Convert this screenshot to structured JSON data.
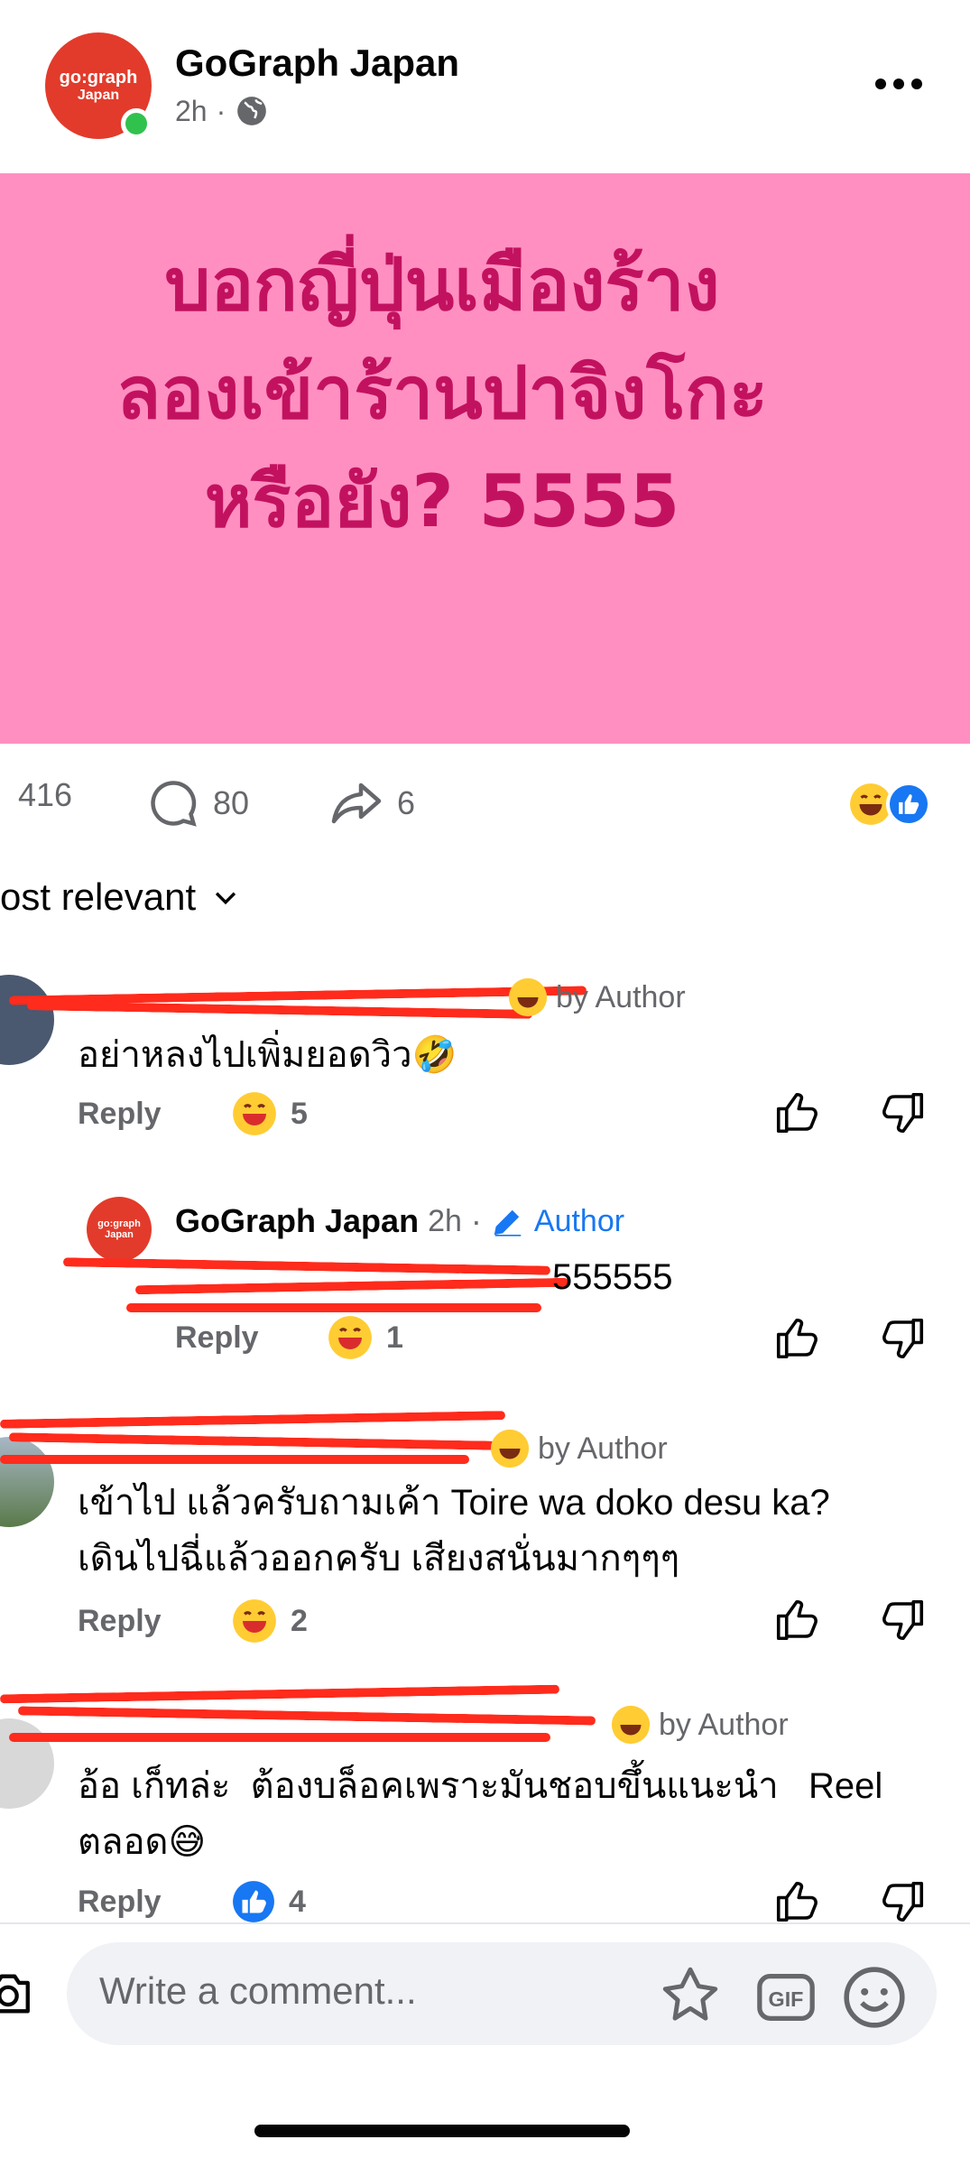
{
  "post": {
    "page_name": "GoGraph Japan",
    "avatar_text_line1": "go:graph",
    "avatar_text_line2": "Japan",
    "time": "2h",
    "separator": "·",
    "privacy_icon": "globe-icon",
    "banner_lines": [
      "บอกญี่ปุ่นเมืองร้าง",
      "ลองเข้าร้านปาจิงโกะ",
      "หรือยัง? 5555"
    ],
    "banner_color": "#ff8fc1",
    "banner_text_color": "#c2125f"
  },
  "stats": {
    "reactions": "416",
    "comments": "80",
    "shares": "6"
  },
  "sort": {
    "label": "ost relevant"
  },
  "comments": [
    {
      "author_tag": "by Author",
      "text": "อย่าหลงไปเพิ่มยอดวิว🤣",
      "reply_label": "Reply",
      "reaction_count": "5"
    },
    {
      "author": "GoGraph Japan",
      "time": "2h",
      "author_badge": "Author",
      "text": "555555",
      "reply_label": "Reply",
      "reaction_count": "1"
    },
    {
      "author_tag": "by Author",
      "text_line1": "เข้าไป แล้วครับถามเค้า Toire wa doko desu ka?",
      "text_line2": "เดินไปฉี่แล้วออกครับ เสียงสนั่นมากๆๆๆ",
      "reply_label": "Reply",
      "reaction_count": "2"
    },
    {
      "author_tag": "by Author",
      "text_line1": "อ้อ เก็ทล่ะ  ต้องบล็อคเพราะมันชอบขึ้นแนะนำ   Reel",
      "text_line2": "ตลอด😅",
      "reply_label": "Reply",
      "reaction_count": "4"
    }
  ],
  "composer": {
    "placeholder": "Write a comment..."
  },
  "colors": {
    "accent": "#1877f2",
    "redaction": "#ff2b1c",
    "online": "#31c24d"
  }
}
